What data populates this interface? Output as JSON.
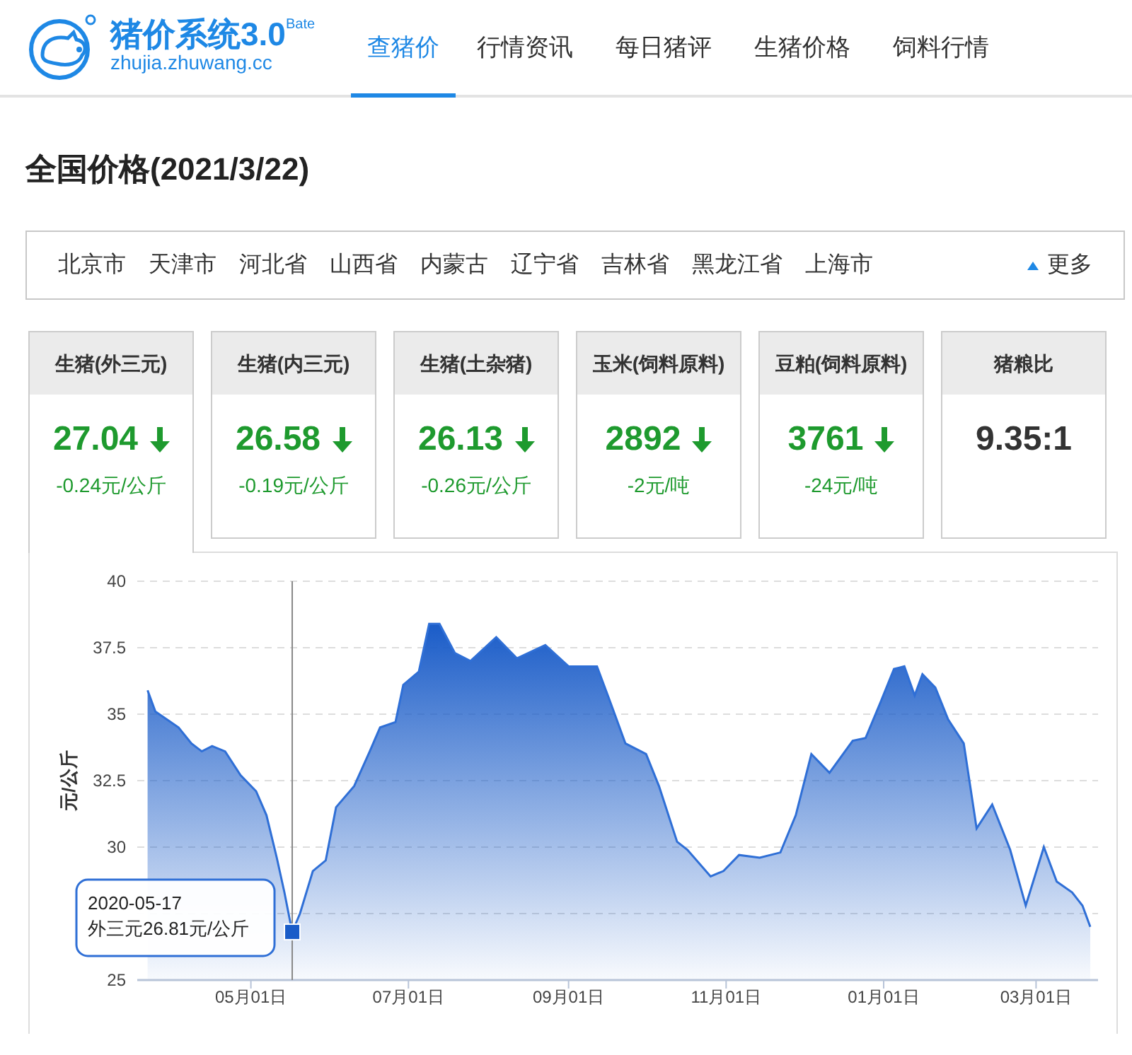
{
  "logo": {
    "title": "猪价系统3.0",
    "superscript": "Bate",
    "url": "zhujia.zhuwang.cc"
  },
  "nav": [
    {
      "label": "查猪价",
      "selected": true
    },
    {
      "label": "行情资讯",
      "selected": false
    },
    {
      "label": "每日猪评",
      "selected": false
    },
    {
      "label": "生猪价格",
      "selected": false
    },
    {
      "label": "饲料行情",
      "selected": false
    }
  ],
  "heading": "全国价格(2021/3/22)",
  "regions": [
    "北京市",
    "天津市",
    "河北省",
    "山西省",
    "内蒙古",
    "辽宁省",
    "吉林省",
    "黑龙江省",
    "上海市"
  ],
  "more": {
    "label": "更多",
    "expanded": true
  },
  "cards": [
    {
      "title": "生猪(外三元)",
      "value": "27.04",
      "change": "-0.24元/公斤",
      "falling": true,
      "selected": true
    },
    {
      "title": "生猪(内三元)",
      "value": "26.58",
      "change": "-0.19元/公斤",
      "falling": true,
      "selected": false
    },
    {
      "title": "生猪(土杂猪)",
      "value": "26.13",
      "change": "-0.26元/公斤",
      "falling": true,
      "selected": false
    },
    {
      "title": "玉米(饲料原料)",
      "value": "2892",
      "change": "-2元/吨",
      "falling": true,
      "selected": false
    },
    {
      "title": "豆粕(饲料原料)",
      "value": "3761",
      "change": "-24元/吨",
      "falling": true,
      "selected": false
    },
    {
      "title": "猪粮比",
      "value": "9.35:1",
      "selected": false
    }
  ],
  "chart": {
    "chart_data": {
      "type": "area",
      "ylabel": "元/公斤",
      "x": [
        "2020-03-22",
        "2020-03-25",
        "2020-04-03",
        "2020-04-08",
        "2020-04-12",
        "2020-04-16",
        "2020-04-21",
        "2020-04-27",
        "2020-05-03",
        "2020-05-07",
        "2020-05-11",
        "2020-05-14",
        "2020-05-17",
        "2020-05-20",
        "2020-05-25",
        "2020-05-30",
        "2020-06-03",
        "2020-06-10",
        "2020-06-16",
        "2020-06-20",
        "2020-06-26",
        "2020-06-29",
        "2020-07-05",
        "2020-07-09",
        "2020-07-13",
        "2020-07-19",
        "2020-07-25",
        "2020-08-04",
        "2020-08-12",
        "2020-08-23",
        "2020-09-01",
        "2020-09-12",
        "2020-09-17",
        "2020-09-23",
        "2020-10-01",
        "2020-10-06",
        "2020-10-13",
        "2020-10-17",
        "2020-10-26",
        "2020-10-31",
        "2020-11-06",
        "2020-11-14",
        "2020-11-22",
        "2020-11-28",
        "2020-12-04",
        "2020-12-11",
        "2020-12-20",
        "2020-12-25",
        "2020-12-31",
        "2021-01-05",
        "2021-01-09",
        "2021-01-13",
        "2021-01-16",
        "2021-01-21",
        "2021-01-26",
        "2021-02-01",
        "2021-02-06",
        "2021-02-12",
        "2021-02-19",
        "2021-02-25",
        "2021-03-04",
        "2021-03-09",
        "2021-03-15",
        "2021-03-19",
        "2021-03-22"
      ],
      "series": [
        {
          "name": "外三元",
          "color": "#1a5cc8",
          "values": [
            35.9,
            35.1,
            34.5,
            33.9,
            33.6,
            33.8,
            33.6,
            32.7,
            32.1,
            31.2,
            29.6,
            28.3,
            26.81,
            27.5,
            29.1,
            29.5,
            31.5,
            32.3,
            33.6,
            34.5,
            34.7,
            36.1,
            36.6,
            38.4,
            38.4,
            37.3,
            37.0,
            37.9,
            37.1,
            37.6,
            36.8,
            36.8,
            35.5,
            33.9,
            33.5,
            32.3,
            30.2,
            29.9,
            28.9,
            29.1,
            29.7,
            29.6,
            29.8,
            31.2,
            33.5,
            32.8,
            34.0,
            34.1,
            35.5,
            36.7,
            36.8,
            35.7,
            36.5,
            36.0,
            34.8,
            33.9,
            30.7,
            31.6,
            29.9,
            27.8,
            30.0,
            28.7,
            28.3,
            27.8,
            27.0
          ]
        }
      ],
      "xlim": [
        "2020-03-18",
        "2021-03-25"
      ],
      "ylim": [
        25,
        40
      ],
      "grid": true,
      "xticks": [
        {
          "value": "2020-05-01",
          "label": "05月01日"
        },
        {
          "value": "2020-07-01",
          "label": "07月01日"
        },
        {
          "value": "2020-09-01",
          "label": "09月01日"
        },
        {
          "value": "2020-11-01",
          "label": "11月01日"
        },
        {
          "value": "2021-01-01",
          "label": "01月01日"
        },
        {
          "value": "2021-03-01",
          "label": "03月01日"
        }
      ],
      "yticks": [
        {
          "value": 25,
          "label": "25"
        },
        {
          "value": 30,
          "label": "30"
        },
        {
          "value": 32.5,
          "label": "32.5"
        },
        {
          "value": 35,
          "label": "35"
        },
        {
          "value": 37.5,
          "label": "37.5"
        },
        {
          "value": 40,
          "label": "40"
        }
      ],
      "ref_lines": [
        {
          "axis": "x",
          "value": "2020-05-17"
        }
      ]
    },
    "tooltip": {
      "date": "2020-05-17",
      "value": "26.81元/公斤"
    }
  }
}
